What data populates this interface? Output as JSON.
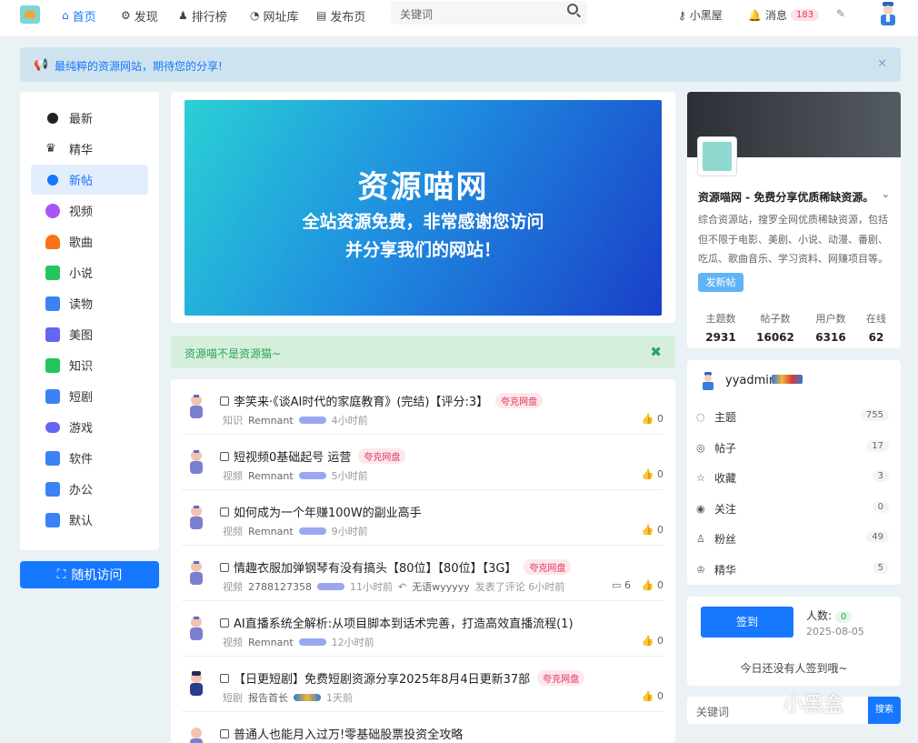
{
  "header": {
    "nav": [
      {
        "label": "首页",
        "icon": "home-icon"
      },
      {
        "label": "发现",
        "icon": "compass-gear-icon"
      },
      {
        "label": "排行榜",
        "icon": "users-icon"
      },
      {
        "label": "网址库",
        "icon": "link-icon"
      },
      {
        "label": "发布页",
        "icon": "document-icon"
      }
    ],
    "search_placeholder": "关键词",
    "user_link": "小黑屋",
    "messages_label": "消息",
    "messages_count": "183"
  },
  "notice": {
    "text": "最纯粹的资源网站，期待您的分享!"
  },
  "sidebar": {
    "items": [
      {
        "label": "最新",
        "color": "#222222"
      },
      {
        "label": "精华",
        "color": "#222222"
      },
      {
        "label": "新帖",
        "color": "#1677ff"
      },
      {
        "label": "视频",
        "color": "#a855f7"
      },
      {
        "label": "歌曲",
        "color": "#f97316"
      },
      {
        "label": "小说",
        "color": "#22c55e"
      },
      {
        "label": "读物",
        "color": "#3b82f6"
      },
      {
        "label": "美图",
        "color": "#6366f1"
      },
      {
        "label": "知识",
        "color": "#22c55e"
      },
      {
        "label": "短剧",
        "color": "#3b82f6"
      },
      {
        "label": "游戏",
        "color": "#6366f1"
      },
      {
        "label": "软件",
        "color": "#3b82f6"
      },
      {
        "label": "办公",
        "color": "#3b82f6"
      },
      {
        "label": "默认",
        "color": "#3b82f6"
      }
    ],
    "random_label": "随机访问"
  },
  "banner": {
    "title": "资源喵网",
    "line1": "全站资源免费，非常感谢您访问",
    "line2": "并分享我们的网站！"
  },
  "announcement": {
    "text": "资源喵不是资源猫~"
  },
  "posts": [
    {
      "title": "李笑来·《谈AI时代的家庭教育》(完结)【评分:3】",
      "tag": "夸克网盘",
      "cat": "知识",
      "author": "Remnant",
      "time": "4小时前",
      "likes": "0",
      "comments": ""
    },
    {
      "title": "短视频0基础起号 运营",
      "tag": "夸克网盘",
      "cat": "视频",
      "author": "Remnant",
      "time": "5小时前",
      "likes": "0",
      "comments": ""
    },
    {
      "title": "如何成为一个年赚100W的副业高手",
      "tag": "",
      "cat": "视频",
      "author": "Remnant",
      "time": "9小时前",
      "likes": "0",
      "comments": ""
    },
    {
      "title": "情趣衣服加弹钢琴有没有搞头【80位】【80位】【3G】",
      "tag": "夸克网盘",
      "cat": "视频",
      "author": "2788127358",
      "time": "11小时前",
      "reply_user": "无语wyyyyy",
      "reply_text": "发表了评论 6小时前",
      "likes": "0",
      "comments": "6"
    },
    {
      "title": "AI直播系统全解析:从项目脚本到话术完善，打造高效直播流程(1)",
      "tag": "",
      "cat": "视频",
      "author": "Remnant",
      "time": "12小时前",
      "likes": "0",
      "comments": ""
    },
    {
      "title": "【日更短剧】免费短剧资源分享2025年8月4日更新37部",
      "tag": "夸克网盘",
      "cat": "短剧",
      "author": "报告首长",
      "time": "1天前",
      "likes": "0",
      "comments": ""
    },
    {
      "title": "普通人也能月入过万!零基础股票投资全攻略",
      "tag": "",
      "cat": "",
      "author": "",
      "time": "",
      "likes": "",
      "comments": ""
    }
  ],
  "site": {
    "name": "资源喵网 - 免费分享优质稀缺资源。",
    "desc": "综合资源站，搜罗全网优质稀缺资源，包括但不限于电影、美剧、小说、动漫、番剧、吃瓜、歌曲音乐、学习资料、网赚项目等。",
    "post_button": "发新帖",
    "stats": [
      {
        "label": "主题数",
        "value": "2931"
      },
      {
        "label": "帖子数",
        "value": "16062"
      },
      {
        "label": "用户数",
        "value": "6316"
      },
      {
        "label": "在线",
        "value": "62"
      }
    ]
  },
  "user": {
    "name": "yyadmin",
    "rows": [
      {
        "label": "主题",
        "icon": "chat-icon",
        "count": "755"
      },
      {
        "label": "帖子",
        "icon": "chat-bubbles-icon",
        "count": "17"
      },
      {
        "label": "收藏",
        "icon": "star-icon",
        "count": "3"
      },
      {
        "label": "关注",
        "icon": "broadcast-icon",
        "count": "0"
      },
      {
        "label": "粉丝",
        "icon": "person-icon",
        "count": "49"
      },
      {
        "label": "精华",
        "icon": "crown-icon",
        "count": "5"
      }
    ]
  },
  "signin": {
    "button": "签到",
    "people_label": "人数:",
    "people_count": "0",
    "date": "2025-08-05",
    "empty_text": "今日还没有人签到哦~"
  },
  "sidebar_search": {
    "placeholder": "关键词",
    "button": "搜索"
  },
  "watermark": "小黑盒"
}
